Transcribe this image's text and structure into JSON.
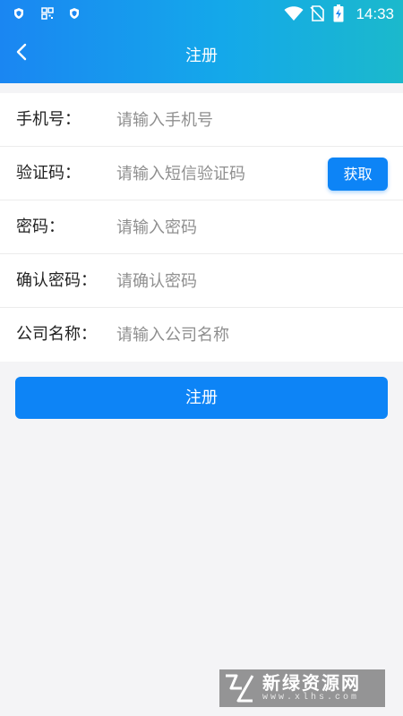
{
  "status_bar": {
    "time": "14:33",
    "left_icons": [
      "shield-icon",
      "grid-icon",
      "shield-icon"
    ],
    "right_icons": [
      "wifi-icon",
      "no-sim-icon",
      "battery-charging-icon"
    ]
  },
  "header": {
    "title": "注册",
    "back_icon": "chevron-left-icon",
    "gradient_colors": [
      "#1a86f2",
      "#1bb9cc"
    ]
  },
  "form": {
    "fields": [
      {
        "label": "手机号：",
        "placeholder": "请输入手机号",
        "value": ""
      },
      {
        "label": "验证码：",
        "placeholder": "请输入短信验证码",
        "value": ""
      },
      {
        "label": "密码：",
        "placeholder": "请输入密码",
        "value": ""
      },
      {
        "label": "确认密码：",
        "placeholder": "请确认密码",
        "value": ""
      },
      {
        "label": "公司名称：",
        "placeholder": "请输入公司名称",
        "value": ""
      }
    ],
    "get_code_label": "获取"
  },
  "submit_label": "注册",
  "accent_color": "#0d84f6",
  "watermark": {
    "title": "新绿资源网",
    "url": "www.xlhs.com"
  }
}
